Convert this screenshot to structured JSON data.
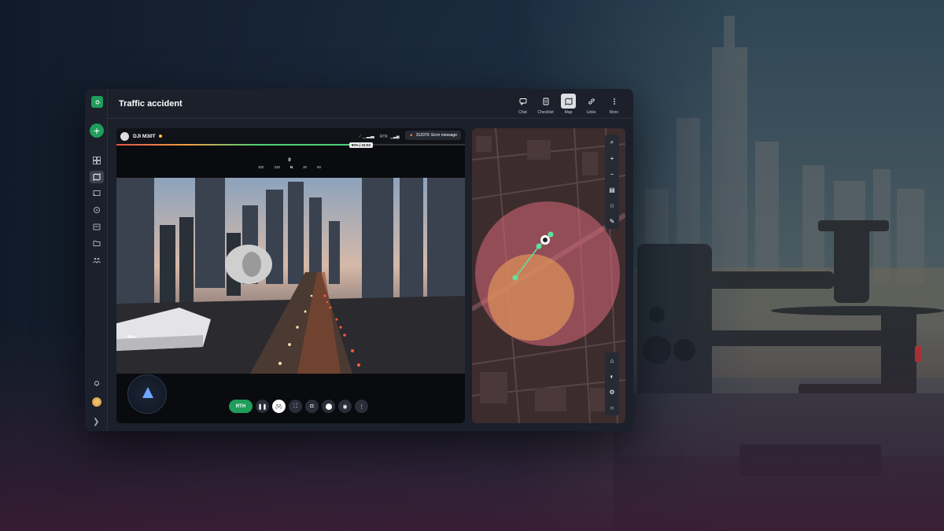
{
  "app": {
    "title": "Traffic accident"
  },
  "toolbar": {
    "items": [
      {
        "label": "Chat",
        "icon": "chat-icon"
      },
      {
        "label": "Checklist",
        "icon": "checklist-icon"
      },
      {
        "label": "Map",
        "icon": "map-icon",
        "active": true
      },
      {
        "label": "Links",
        "icon": "link-icon"
      },
      {
        "label": "More",
        "icon": "more-icon"
      }
    ]
  },
  "sidebar": {
    "items": [
      {
        "icon": "dashboard-icon"
      },
      {
        "icon": "map-icon",
        "active": true
      },
      {
        "icon": "cast-icon"
      },
      {
        "icon": "target-icon"
      },
      {
        "icon": "garage-icon"
      },
      {
        "icon": "folder-icon"
      },
      {
        "icon": "team-icon"
      }
    ],
    "bottom": [
      "bell-icon",
      "avatar",
      "chevron-right-icon"
    ]
  },
  "video": {
    "drone_name": "DJI M30T",
    "error_message": "312070: Error message",
    "battery_text": "90% | 24:53",
    "battery_fraction": 0.68,
    "compass_heading": "0",
    "compass_ticks": [
      "300",
      "330",
      "N",
      "30",
      "60"
    ],
    "altitude": "40m",
    "signal_label": "RTK"
  },
  "controls": {
    "rth_label": "RTH",
    "buttons": [
      "pause-icon",
      "gamepad-icon",
      "focus-icon",
      "camera-icon",
      "record-icon",
      "eye-off-icon",
      "more-icon"
    ]
  },
  "colors": {
    "accent": "#1f9d5a",
    "window_bg": "#1b202b",
    "error": "#f06a4a"
  }
}
